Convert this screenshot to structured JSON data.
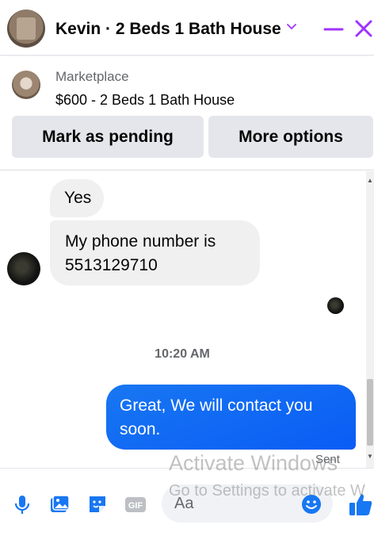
{
  "header": {
    "title": "Kevin · 2 Beds 1 Bath House",
    "accent_color": "#a033ff"
  },
  "marketplace": {
    "label": "Marketplace",
    "listing": "$600 - 2 Beds 1 Bath House",
    "mark_pending_label": "Mark as pending",
    "more_options_label": "More options"
  },
  "messages": {
    "incoming": [
      "Yes",
      "My phone number is 5513129710"
    ],
    "timestamp": "10:20 AM",
    "outgoing": "Great, We will contact you soon.",
    "status": "Sent"
  },
  "composer": {
    "placeholder": "Aa",
    "icons": [
      "microphone-icon",
      "photo-icon",
      "sticker-icon",
      "gif-icon",
      "emoji-icon",
      "thumbs-up-icon"
    ]
  },
  "watermark": {
    "line1": "Activate Windows",
    "line2": "Go to Settings to activate W"
  },
  "colors": {
    "messenger_blue": "#1877f2",
    "bubble_gray": "#f0f0f0",
    "button_gray": "#e4e6eb"
  }
}
